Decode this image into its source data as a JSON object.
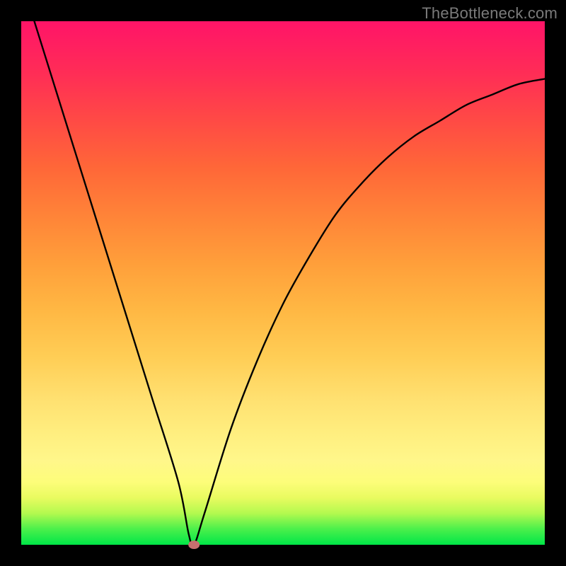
{
  "watermark": "TheBottleneck.com",
  "chart_data": {
    "type": "line",
    "title": "",
    "xlabel": "",
    "ylabel": "",
    "xlim": [
      0,
      100
    ],
    "ylim": [
      0,
      100
    ],
    "grid": false,
    "legend": false,
    "series": [
      {
        "name": "bottleneck-curve",
        "x": [
          0,
          5,
          10,
          15,
          20,
          25,
          30,
          32,
          33,
          35,
          40,
          45,
          50,
          55,
          60,
          65,
          70,
          75,
          80,
          85,
          90,
          95,
          100
        ],
        "y": [
          108,
          92,
          76,
          60,
          44,
          28,
          12,
          2,
          0,
          6,
          22,
          35,
          46,
          55,
          63,
          69,
          74,
          78,
          81,
          84,
          86,
          88,
          89
        ]
      }
    ],
    "minimum_marker": {
      "x": 33,
      "y": 0
    },
    "background_gradient": {
      "bottom": "#00e648",
      "top": "#ff1468"
    }
  }
}
